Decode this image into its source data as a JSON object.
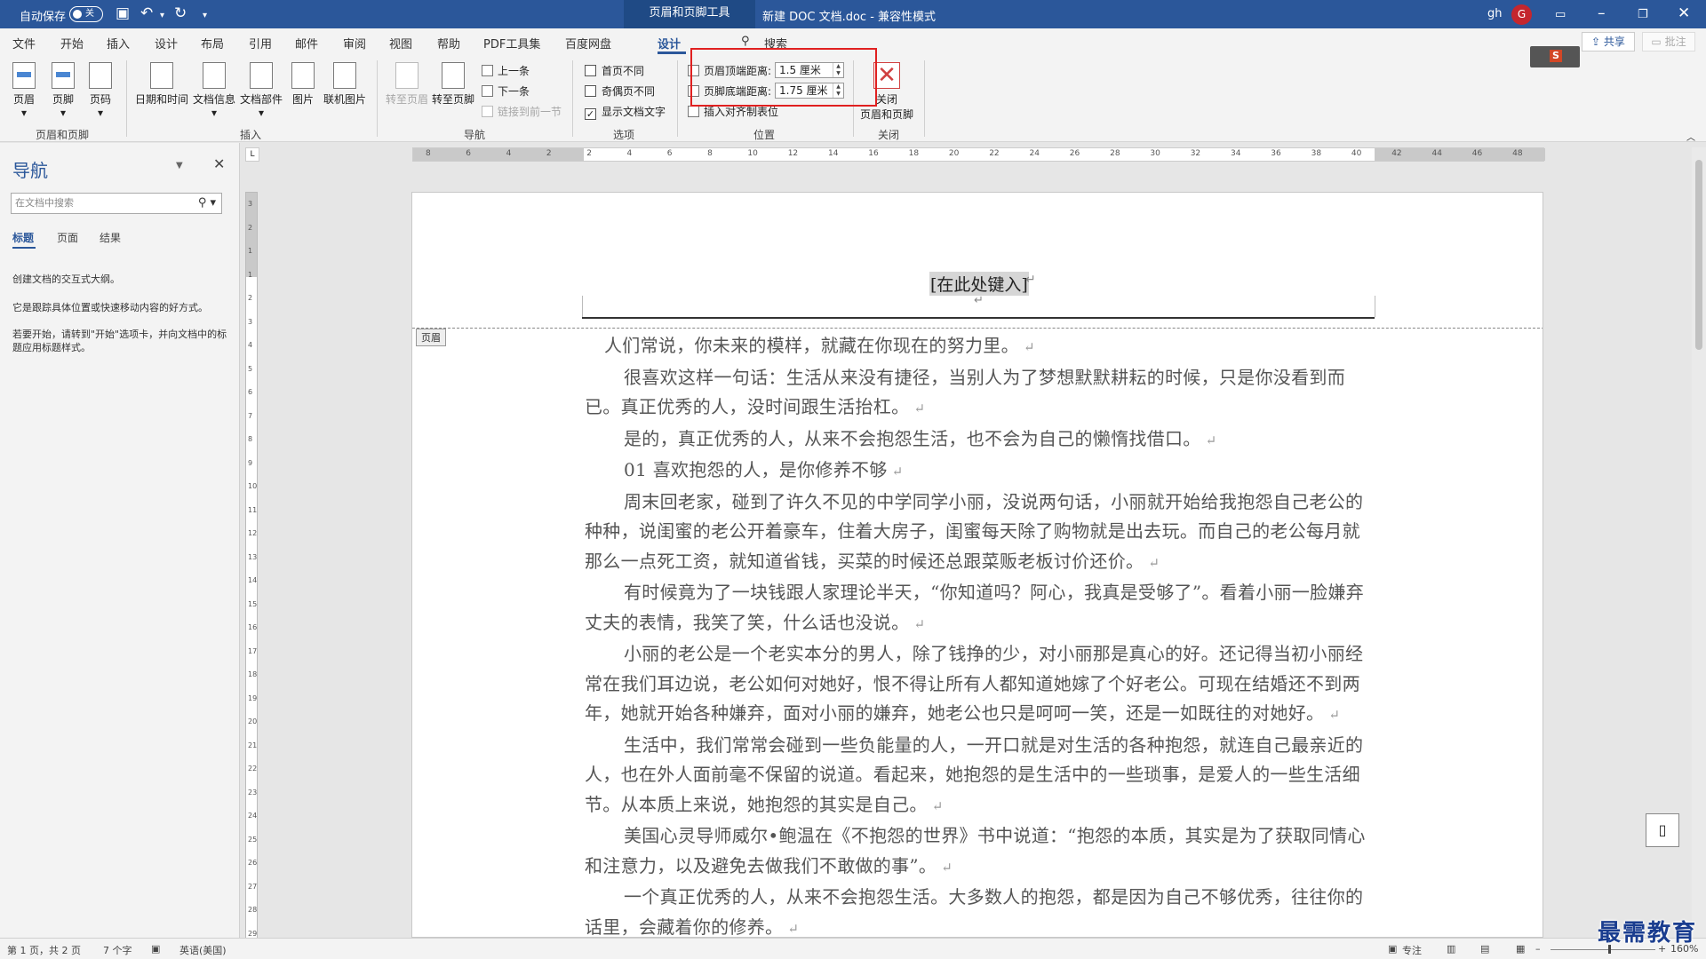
{
  "titlebar": {
    "autosave_label": "自动保存",
    "autosave_state": "关",
    "context_tab": "页眉和页脚工具",
    "doc_title": "新建 DOC 文档.doc  -  兼容性模式",
    "user_name": "gh",
    "avatar_initial": "G"
  },
  "tabs": [
    "文件",
    "开始",
    "插入",
    "设计",
    "布局",
    "引用",
    "邮件",
    "审阅",
    "视图",
    "帮助",
    "PDF工具集",
    "百度网盘",
    "设计"
  ],
  "search_label": "搜索",
  "share_label": "共享",
  "comment_label": "批注",
  "ribbon": {
    "header": "页眉",
    "footer": "页脚",
    "page_number": "页码",
    "group_header_footer": "页眉和页脚",
    "date_time": "日期和时间",
    "doc_info": "文档信息",
    "doc_parts": "文档部件",
    "picture": "图片",
    "online_picture": "联机图片",
    "group_insert": "插入",
    "goto_header": "转至页眉",
    "goto_footer": "转至页脚",
    "previous": "上一条",
    "next": "下一条",
    "link_previous": "链接到前一节",
    "group_nav": "导航",
    "first_page_diff": "首页不同",
    "odd_even_diff": "奇偶页不同",
    "show_doc_text": "显示文档文字",
    "group_options": "选项",
    "header_top_label": "页眉顶端距离:",
    "header_top_value": "1.5 厘米",
    "footer_bottom_label": "页脚底端距离:",
    "footer_bottom_value": "1.75 厘米",
    "insert_align_tab": "插入对齐制表位",
    "group_position": "位置",
    "close_line1": "关闭",
    "close_line2": "页眉和页脚",
    "group_close": "关闭"
  },
  "nav": {
    "title": "导航",
    "search_placeholder": "在文档中搜索",
    "tab_headings": "标题",
    "tab_pages": "页面",
    "tab_results": "结果",
    "msg1": "创建文档的交互式大纲。",
    "msg2": "它是跟踪具体位置或快速移动内容的好方式。",
    "msg3": "若要开始，请转到\"开始\"选项卡，并向文档中的标题应用标题样式。"
  },
  "ruler": {
    "h_numbers": [
      "8",
      "6",
      "4",
      "2",
      "2",
      "4",
      "6",
      "8",
      "10",
      "12",
      "14",
      "16",
      "18",
      "20",
      "22",
      "24",
      "26",
      "28",
      "30",
      "32",
      "34",
      "36",
      "38",
      "40",
      "42",
      "44",
      "46",
      "48"
    ],
    "v_numbers": [
      "3",
      "2",
      "1",
      "1",
      "2",
      "3",
      "4",
      "5",
      "6",
      "7",
      "8",
      "9",
      "10",
      "11",
      "12",
      "13",
      "14",
      "15",
      "16",
      "17",
      "18",
      "19",
      "20",
      "21",
      "22",
      "23",
      "24",
      "25",
      "26",
      "27",
      "28",
      "29"
    ],
    "corner": "L"
  },
  "page": {
    "header_placeholder": "[在此处键入]",
    "header_tag": "页眉",
    "paragraphs": [
      "人们常说，你未来的模样，就藏在你现在的努力里。",
      "很喜欢这样一句话：生活从来没有捷径，当别人为了梦想默默耕耘的时候，只是你没看到而已。真正优秀的人，没时间跟生活抬杠。",
      "是的，真正优秀的人，从来不会抱怨生活，也不会为自己的懒惰找借口。",
      "01  喜欢抱怨的人，是你修养不够",
      "周末回老家，碰到了许久不见的中学同学小丽，没说两句话，小丽就开始给我抱怨自己老公的种种，说闺蜜的老公开着豪车，住着大房子，闺蜜每天除了购物就是出去玩。而自己的老公每月就那么一点死工资，就知道省钱，买菜的时候还总跟菜贩老板讨价还价。",
      "有时候竟为了一块钱跟人家理论半天，“你知道吗？阿心，我真是受够了”。看着小丽一脸嫌弃丈夫的表情，我笑了笑，什么话也没说。",
      "小丽的老公是一个老实本分的男人，除了钱挣的少，对小丽那是真心的好。还记得当初小丽经常在我们耳边说，老公如何对她好，恨不得让所有人都知道她嫁了个好老公。可现在结婚还不到两年，她就开始各种嫌弃，面对小丽的嫌弃，她老公也只是呵呵一笑，还是一如既往的对她好。",
      "生活中，我们常常会碰到一些负能量的人，一开口就是对生活的各种抱怨，就连自己最亲近的人，也在外人面前毫不保留的说道。看起来，她抱怨的是生活中的一些琐事，是爱人的一些生活细节。从本质上来说，她抱怨的其实是自己。",
      "美国心灵导师威尔•鲍温在《不抱怨的世界》书中说道：“抱怨的本质，其实是为了获取同情心和注意力，以及避免去做我们不敢做的事”。",
      "一个真正优秀的人，从来不会抱怨生活。大多数人的抱怨，都是因为自己不够优秀，往往你的话里，会藏着你的修养。"
    ]
  },
  "status": {
    "page": "第 1 页，共 2 页",
    "words": "7 个字",
    "language": "英语(美国)",
    "focus": "专注",
    "zoom": "160%"
  },
  "watermark": "最需教育",
  "colors": {
    "accent": "#2b579a",
    "highlight_box": "#e02020"
  }
}
